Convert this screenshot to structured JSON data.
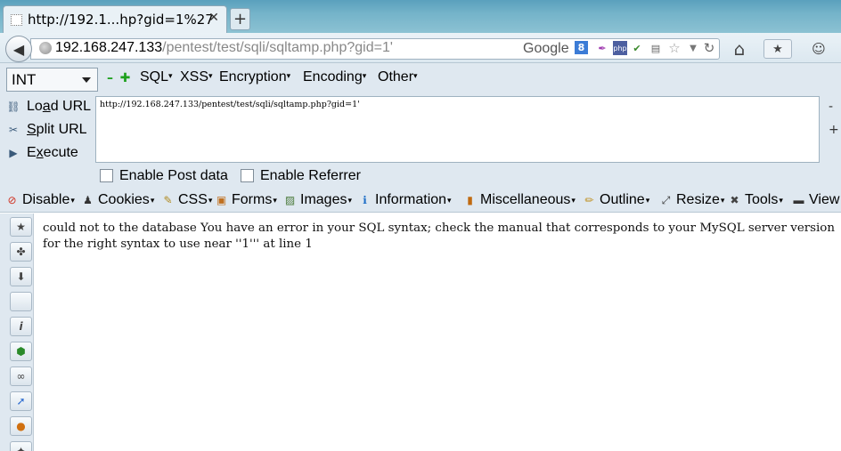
{
  "tab": {
    "title": "http://192.1...hp?gid=1%27",
    "close": "✕",
    "new_tab": "+"
  },
  "navbar": {
    "back": "◀",
    "url_host": "192.168.247.133",
    "url_path": "/pentest/test/sqli/sqltamp.php?gid=1'",
    "search_engine": "Google",
    "search_badge": "8",
    "php_label": "php",
    "reload": "↻",
    "home": "⌂",
    "bookmarks": "★",
    "persona": "☺"
  },
  "hackbar": {
    "select_value": "INT",
    "menus": [
      "SQL",
      "XSS",
      "Encryption",
      "Encoding",
      "Other"
    ],
    "load_url": {
      "pre": "Lo",
      "u": "a",
      "post": "d URL"
    },
    "split_url": {
      "pre": "",
      "u": "S",
      "post": "plit URL"
    },
    "execute": {
      "pre": "E",
      "u": "x",
      "post": "ecute"
    },
    "url_value": "http://192.168.247.133/pentest/test/sqli/sqltamp.php?gid=1'",
    "enable_post": "Enable Post data",
    "enable_referrer": "Enable Referrer",
    "minus": "-",
    "plus": "+"
  },
  "webdev": {
    "items": [
      "Disable",
      "Cookies",
      "CSS",
      "Forms",
      "Images",
      "Information",
      "Miscellaneous",
      "Outline",
      "Resize",
      "Tools",
      "View"
    ]
  },
  "content": {
    "message": "could not to the database You have an error in your SQL syntax; check the manual that corresponds to your MySQL server version for the right syntax to use near ''1''' at line 1"
  },
  "colors": {
    "tabstrip": "#74b3c9",
    "toolbar": "#dfe8f0",
    "badge": "#3c7cd6"
  }
}
